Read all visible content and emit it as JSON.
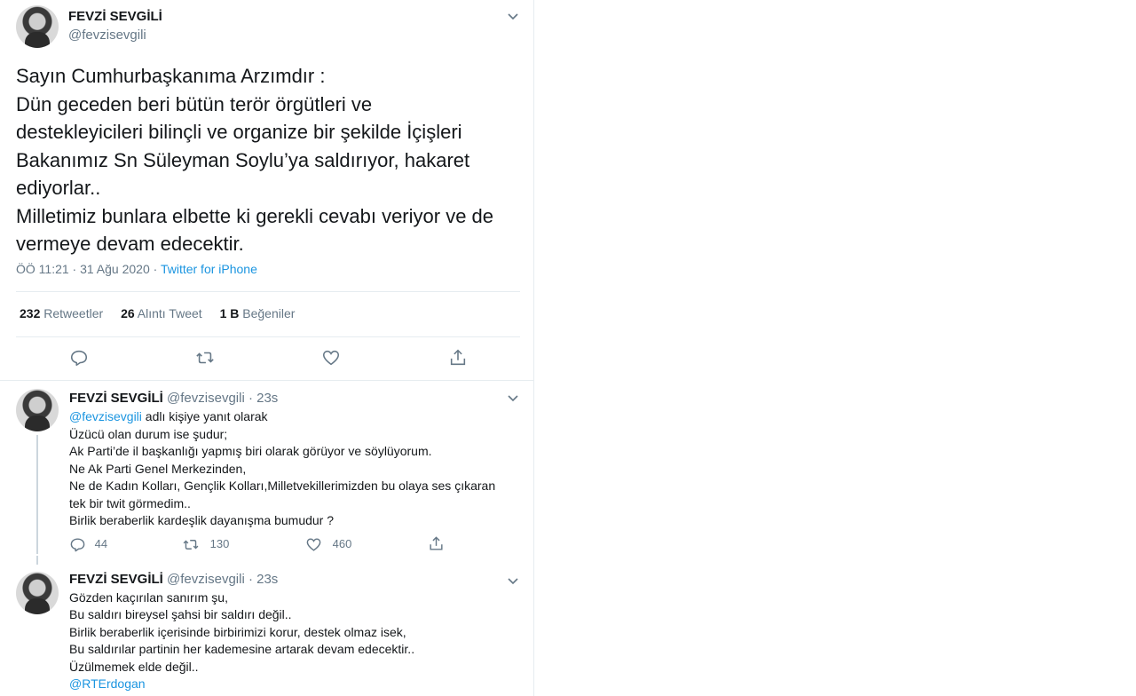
{
  "main_tweet": {
    "author_name": "FEVZİ SEVGİLİ",
    "author_handle": "@fevzisevgili",
    "lines": [
      "Sayın Cumhurbaşkanıma Arzımdır :",
      "Dün geceden beri bütün terör örgütleri ve",
      "destekleyicileri bilinçli ve organize bir şekilde İçişleri",
      "Bakanımız Sn Süleyman Soylu’ya saldırıyor, hakaret",
      "ediyorlar..",
      "Milletimiz bunlara elbette ki gerekli cevabı veriyor ve de",
      "vermeye devam edecektir."
    ],
    "time": "ÖÖ 11:21 · 31 Ağu 2020 · ",
    "source": "Twitter for iPhone",
    "stats": {
      "retweets_count": "232",
      "retweets_label": "Retweetler",
      "quotes_count": "26",
      "quotes_label": "Alıntı Tweet",
      "likes_count": "1 B",
      "likes_label": "Beğeniler"
    }
  },
  "replies": [
    {
      "author_name": "FEVZİ SEVGİLİ",
      "author_handle": "@fevzisevgili · 23s",
      "reply_to_handle": "@fevzisevgili",
      "reply_to_suffix": " adlı kişiye yanıt olarak",
      "lines": [
        "Üzücü olan durum ise şudur;",
        "Ak Parti’de il başkanlığı yapmış biri olarak görüyor ve söylüyorum.",
        "Ne Ak Parti Genel Merkezinden,",
        "Ne de Kadın Kolları, Gençlik Kolları,Milletvekillerimizden bu olaya ses çıkaran",
        "tek bir twit görmedim..",
        "Birlik beraberlik kardeşlik dayanışma bumudur ?"
      ],
      "reply_count": "44",
      "retweet_count": "130",
      "like_count": "460"
    },
    {
      "author_name": "FEVZİ SEVGİLİ",
      "author_handle": "@fevzisevgili · 23s",
      "lines": [
        "Gözden kaçırılan sanırım şu,",
        "Bu saldırı bireysel şahsi bir saldırı değil..",
        "Birlik beraberlik içerisinde birbirimizi korur, destek olmaz isek,",
        "Bu saldırılar partinin her kademesine artarak devam edecektir..",
        "Üzülmemek elde değil.."
      ],
      "mention": "@RTErdogan"
    }
  ],
  "icons": {
    "chevron": "chevron-down-icon",
    "reply": "reply-icon",
    "retweet": "retweet-icon",
    "like": "heart-icon",
    "share": "share-icon"
  },
  "colors": {
    "link": "#1b95e0",
    "muted": "#657786",
    "text": "#14171a",
    "border": "#e6ecf0"
  }
}
